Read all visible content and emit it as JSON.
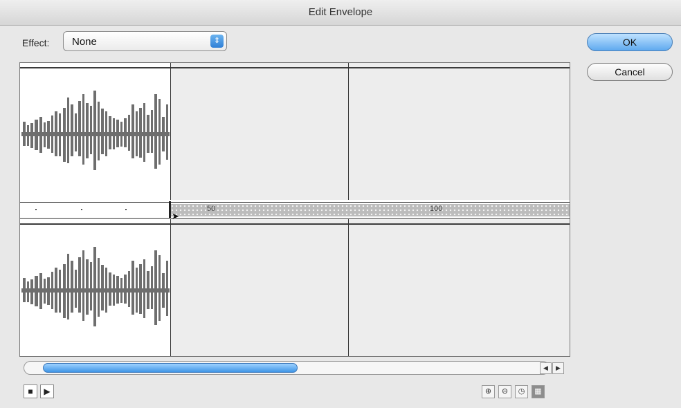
{
  "window": {
    "title": "Edit Envelope"
  },
  "effect": {
    "label": "Effect:",
    "value": "None"
  },
  "buttons": {
    "ok": "OK",
    "cancel": "Cancel"
  },
  "timeline": {
    "ticks": [
      "50",
      "100"
    ]
  },
  "controls": {
    "stop_icon": "stop-icon",
    "play_icon": "play-icon",
    "zoom_in_icon": "zoom-in-icon",
    "zoom_out_icon": "zoom-out-icon",
    "seconds_icon": "seconds-icon",
    "frames_icon": "frames-icon"
  },
  "colors": {
    "accent": "#3f96e6",
    "waveform": "#6e6e6e",
    "envelope": "#3b3b3b"
  }
}
